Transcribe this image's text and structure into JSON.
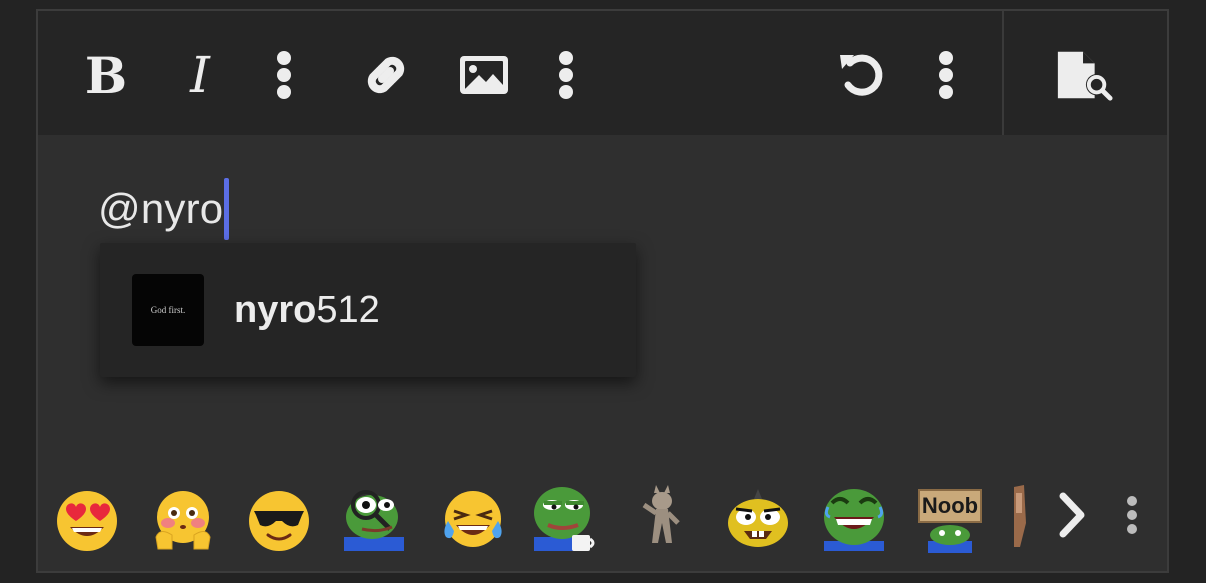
{
  "toolbar": {
    "bold_glyph": "B",
    "italic_glyph": "I",
    "icons": [
      "bold-icon",
      "italic-icon",
      "more-vertical-icon",
      "link-icon",
      "image-icon",
      "more-vertical-icon",
      "undo-icon",
      "more-vertical-icon",
      "document-search-icon"
    ]
  },
  "editor": {
    "typed_text": "@nyro"
  },
  "mention_popup": {
    "results": [
      {
        "avatar_text": "God first.",
        "match": "nyro",
        "rest": "512"
      }
    ]
  },
  "emoji_bar": {
    "items": [
      "heart-eyes-emoji",
      "blushing-hands-emoji",
      "sunglasses-emoji",
      "pepe-magnifier-sticker",
      "crying-laughing-emoji",
      "pepe-coffee-sticker",
      "dancing-cat-sticker",
      "crazy-face-sticker",
      "pepe-laughing-sticker"
    ],
    "noob_sticker_text": "Noob",
    "icons": [
      "chevron-right-icon",
      "more-vertical-icon"
    ]
  },
  "colors": {
    "background": "#232323",
    "editor": "#2f2f2f",
    "toolbar": "#252525",
    "caret": "#5b6ee6",
    "text": "#ececec"
  }
}
